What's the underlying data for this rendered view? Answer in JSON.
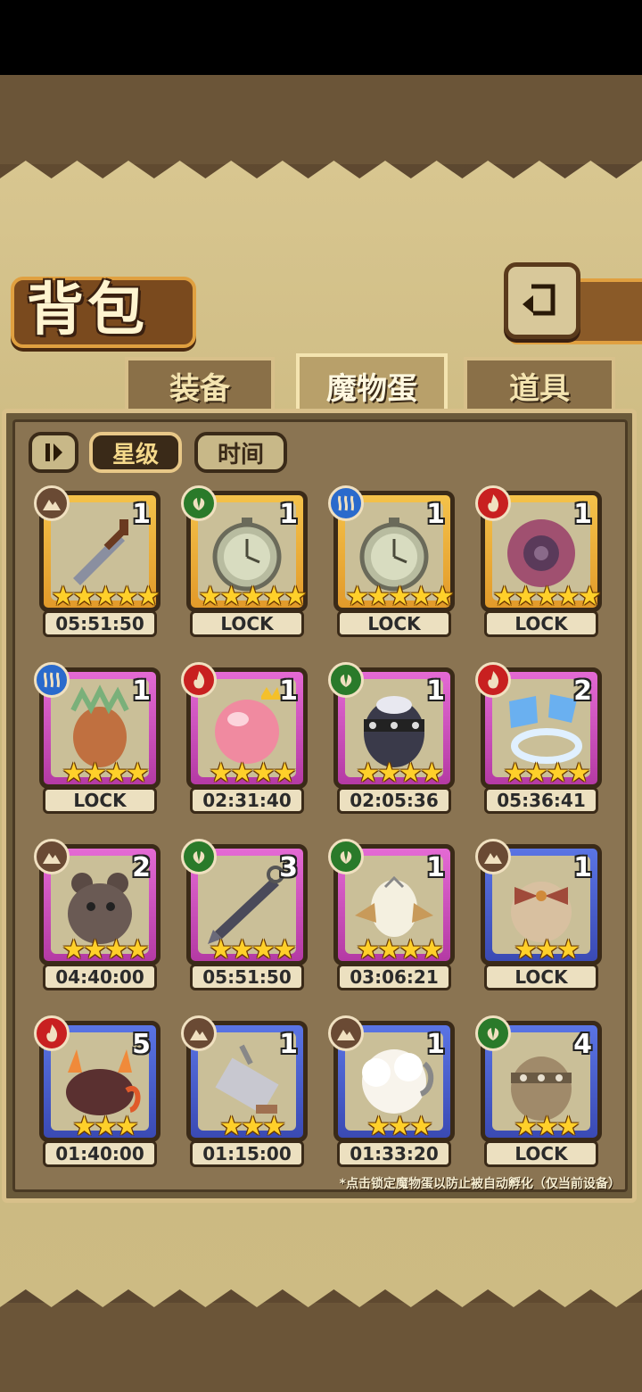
{
  "screen": {
    "title": "背包",
    "back_icon": "return-arrow-icon"
  },
  "tabs": [
    {
      "label": "装备",
      "active": false
    },
    {
      "label": "魔物蛋",
      "active": true
    },
    {
      "label": "道具",
      "active": false
    }
  ],
  "sort": {
    "toggle_icon": "pause-order-icon",
    "star_label": "星级",
    "time_label": "时间",
    "selected": "星级"
  },
  "items": [
    {
      "element": "earth",
      "rarity": "gold",
      "art": "sword",
      "count": "1",
      "stars": 5,
      "label": "05:51:50"
    },
    {
      "element": "grass",
      "rarity": "gold",
      "art": "pocket-watch",
      "count": "1",
      "stars": 5,
      "label": "LOCK"
    },
    {
      "element": "water",
      "rarity": "gold",
      "art": "pocket-watch",
      "count": "1",
      "stars": 5,
      "label": "LOCK"
    },
    {
      "element": "fire",
      "rarity": "gold",
      "art": "orb",
      "count": "1",
      "stars": 5,
      "label": "LOCK"
    },
    {
      "element": "water",
      "rarity": "purple",
      "art": "feather-egg",
      "count": "1",
      "stars": 4,
      "label": "LOCK"
    },
    {
      "element": "fire",
      "rarity": "purple",
      "art": "crowned-orb",
      "count": "1",
      "stars": 4,
      "label": "02:31:40"
    },
    {
      "element": "grass",
      "rarity": "purple",
      "art": "spiked-egg",
      "count": "1",
      "stars": 4,
      "label": "02:05:36"
    },
    {
      "element": "fire",
      "rarity": "purple",
      "art": "flag-ring",
      "count": "2",
      "stars": 4,
      "label": "05:36:41"
    },
    {
      "element": "earth",
      "rarity": "purple",
      "art": "bear",
      "count": "2",
      "stars": 4,
      "label": "04:40:00"
    },
    {
      "element": "grass",
      "rarity": "purple",
      "art": "kunai",
      "count": "3",
      "stars": 4,
      "label": "05:51:50"
    },
    {
      "element": "grass",
      "rarity": "purple",
      "art": "winged-egg",
      "count": "1",
      "stars": 4,
      "label": "03:06:21"
    },
    {
      "element": "earth",
      "rarity": "blue",
      "art": "bow-egg",
      "count": "1",
      "stars": 3,
      "label": "LOCK"
    },
    {
      "element": "fire",
      "rarity": "blue",
      "art": "flame-beast",
      "count": "5",
      "stars": 3,
      "label": "01:40:00"
    },
    {
      "element": "earth",
      "rarity": "blue",
      "art": "cleaver",
      "count": "1",
      "stars": 3,
      "label": "01:15:00"
    },
    {
      "element": "earth",
      "rarity": "blue",
      "art": "fluffy-egg",
      "count": "1",
      "stars": 3,
      "label": "01:33:20"
    },
    {
      "element": "grass",
      "rarity": "blue",
      "art": "studded-egg",
      "count": "4",
      "stars": 3,
      "label": "LOCK"
    }
  ],
  "footnote": "*点击锁定魔物蛋以防止被自动孵化（仅当前设备）",
  "colors": {
    "gold_frame": "#f4c24a",
    "purple_frame": "#e46ad4",
    "blue_frame": "#5a74e4",
    "star": "#ffd02a"
  }
}
